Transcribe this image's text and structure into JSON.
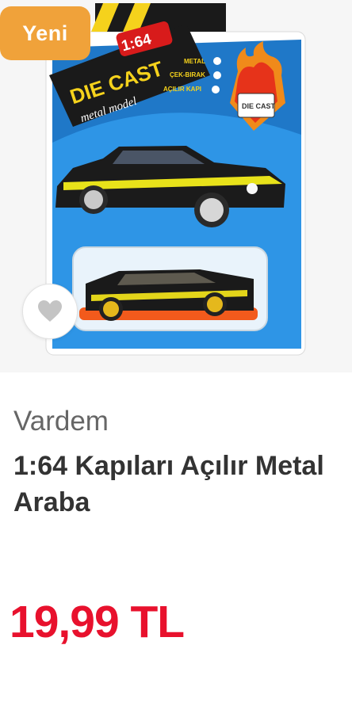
{
  "badge": {
    "label": "Yeni",
    "color": "#f0a23a"
  },
  "product": {
    "brand": "Vardem",
    "title": "1:64 Kapıları Açılır Metal Araba",
    "price": "19,99 TL",
    "price_color": "#e8112d"
  },
  "packaging": {
    "scale": "1:64",
    "line1": "DIE CAST",
    "line2": "metal model",
    "features": [
      "METAL",
      "ÇEK-BIRAK",
      "AÇILIR KAPI"
    ],
    "emblem": "DIE CAST"
  },
  "icons": {
    "favorite": "heart-icon"
  }
}
